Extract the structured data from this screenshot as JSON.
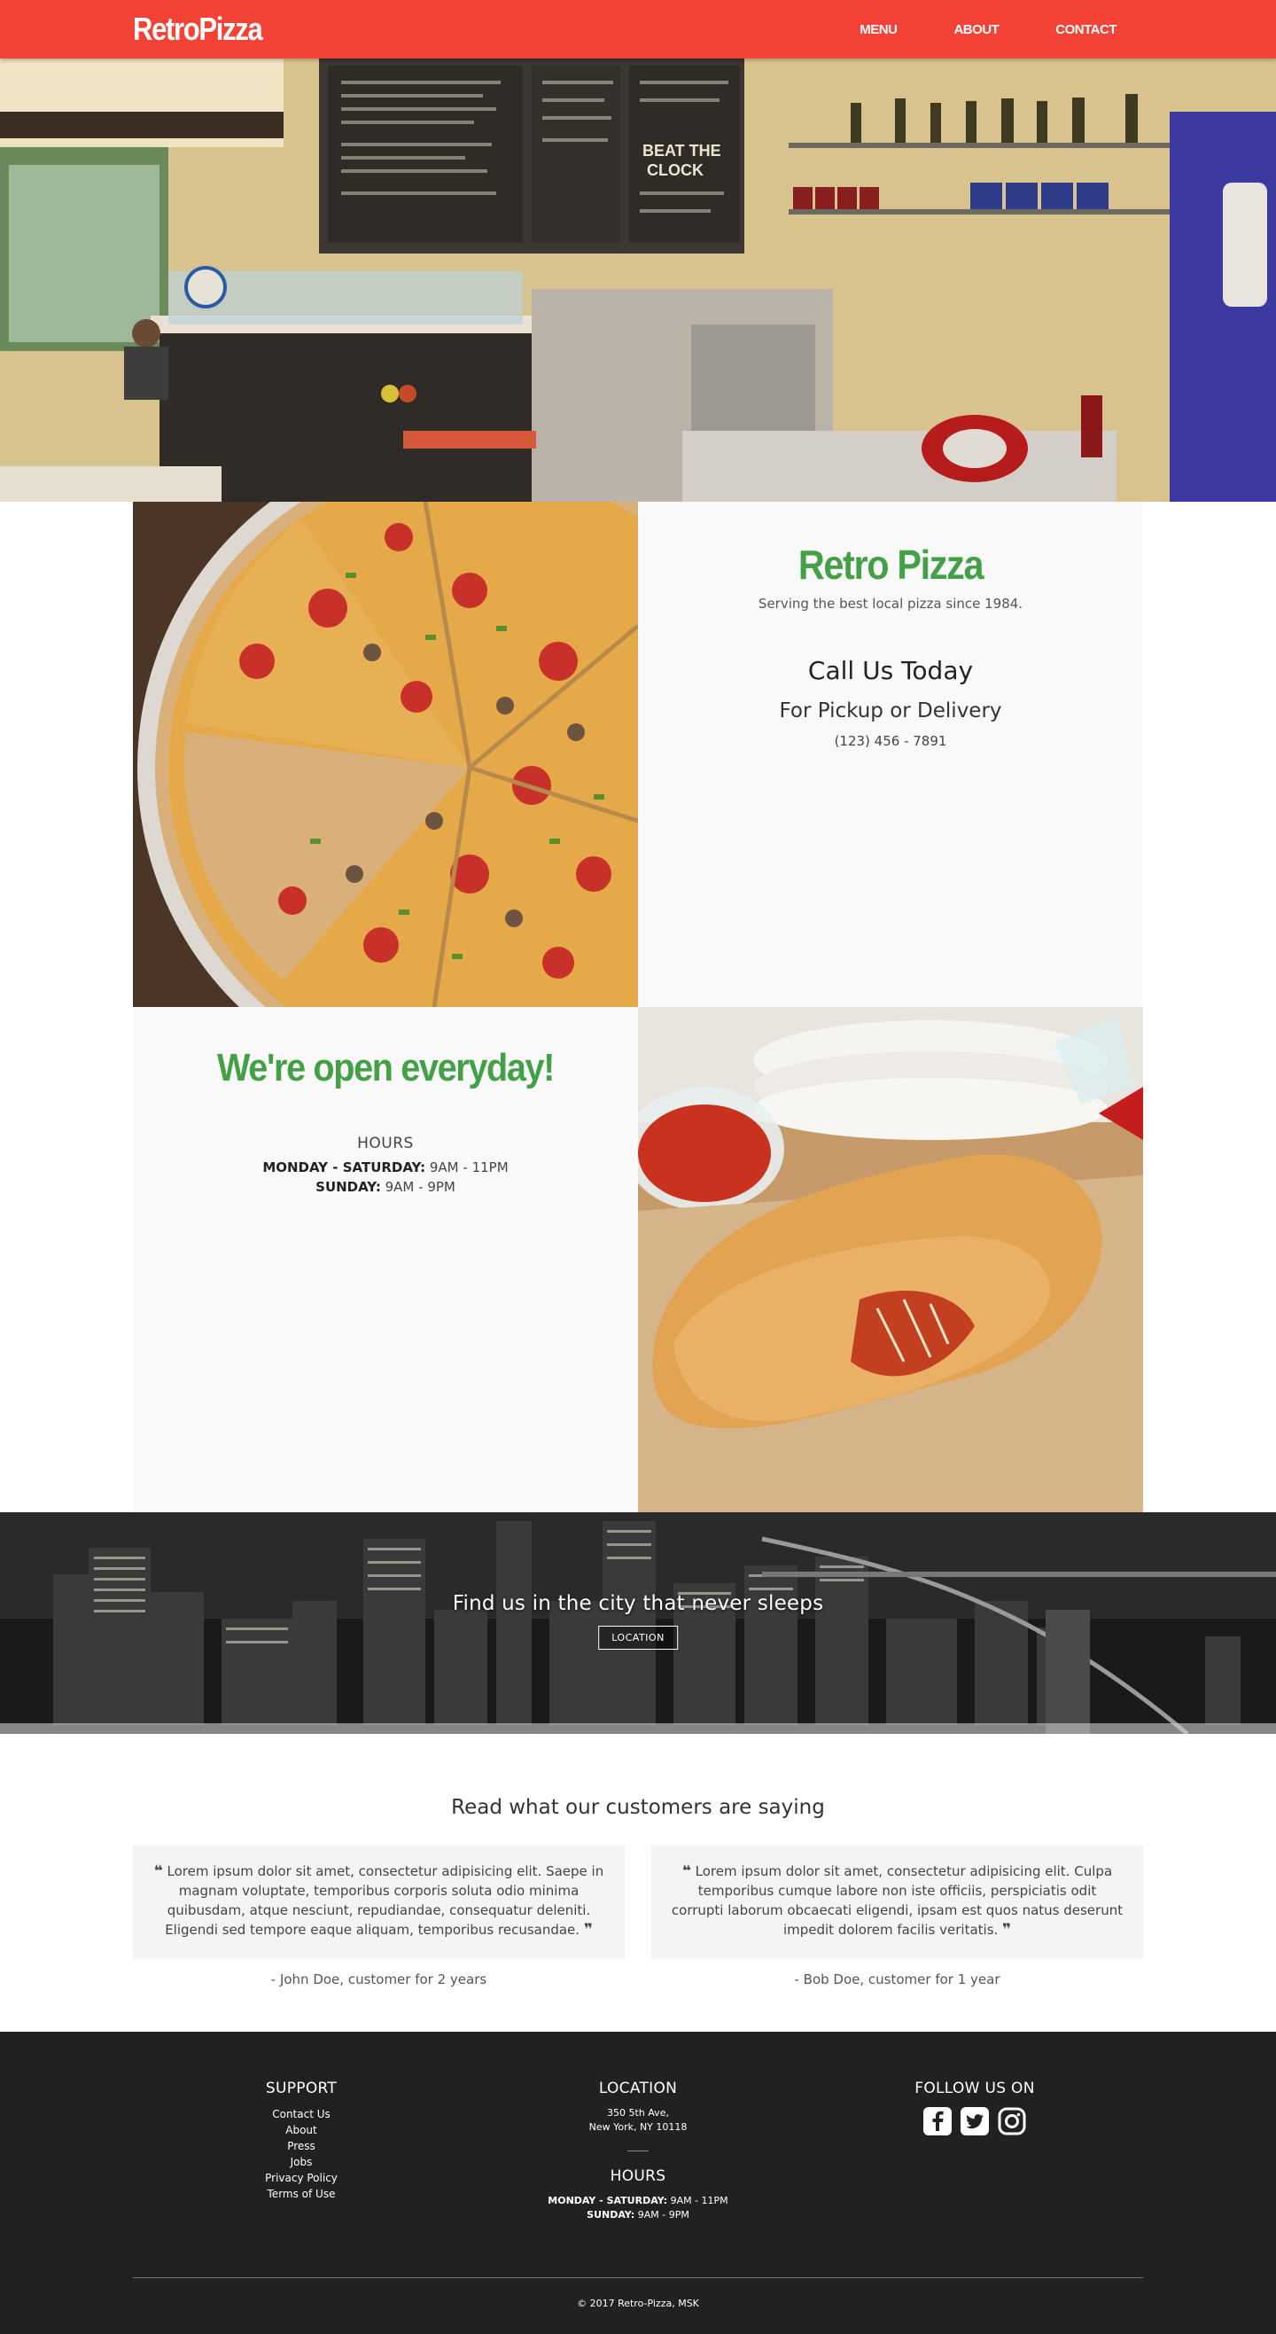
{
  "nav": {
    "brand": "RetroPizza",
    "links": [
      "MENU",
      "ABOUT",
      "CONTACT"
    ],
    "color": "#f44336"
  },
  "intro": {
    "title": "Retro Pizza",
    "tagline": "Serving the best local pizza since 1984.",
    "call_title": "Call Us Today",
    "call_sub": "For Pickup or Delivery",
    "phone": "(123) 456 - 7891"
  },
  "hours_section": {
    "title": "We're open everyday!",
    "heading": "HOURS",
    "weekday_label": "MONDAY - SATURDAY:",
    "weekday_value": " 9AM - 11PM",
    "sunday_label": "SUNDAY:",
    "sunday_value": " 9AM - 9PM",
    "accent": "#43a047"
  },
  "city_banner": {
    "text": "Find us in the city that never sleeps",
    "button": "LOCATION"
  },
  "testimonials": {
    "title": "Read what our customers are saying",
    "items": [
      {
        "quote": " Lorem ipsum dolor sit amet, consectetur adipisicing elit. Saepe in magnam voluptate, temporibus corporis soluta odio minima quibusdam, atque nesciunt, repudiandae, consequatur deleniti. Eligendi sed tempore eaque aliquam, temporibus recusandae. ",
        "author": "- John Doe, customer for 2 years"
      },
      {
        "quote": " Lorem ipsum dolor sit amet, consectetur adipisicing elit. Culpa temporibus cumque labore non iste officiis, perspiciatis odit corrupti laborum obcaecati eligendi, ipsam est quos natus deserunt impedit dolorem facilis veritatis. ",
        "author": "- Bob Doe, customer for 1 year"
      }
    ]
  },
  "footer": {
    "support_title": "SUPPORT",
    "support_links": [
      "Contact Us",
      "About",
      "Press",
      "Jobs",
      "Privacy Policy",
      "Terms of Use"
    ],
    "location_title": "LOCATION",
    "address_1": "350 5th Ave,",
    "address_2": "New York, NY 10118",
    "hours_title": "HOURS",
    "weekday_label": "MONDAY - SATURDAY:",
    "weekday_value": " 9AM - 11PM",
    "sunday_label": "SUNDAY:",
    "sunday_value": " 9AM - 9PM",
    "follow_title": "FOLLOW US ON",
    "social_icons": [
      "facebook-icon",
      "twitter-icon",
      "instagram-icon"
    ],
    "copyright": "© 2017 Retro-Pizza, MSK"
  }
}
